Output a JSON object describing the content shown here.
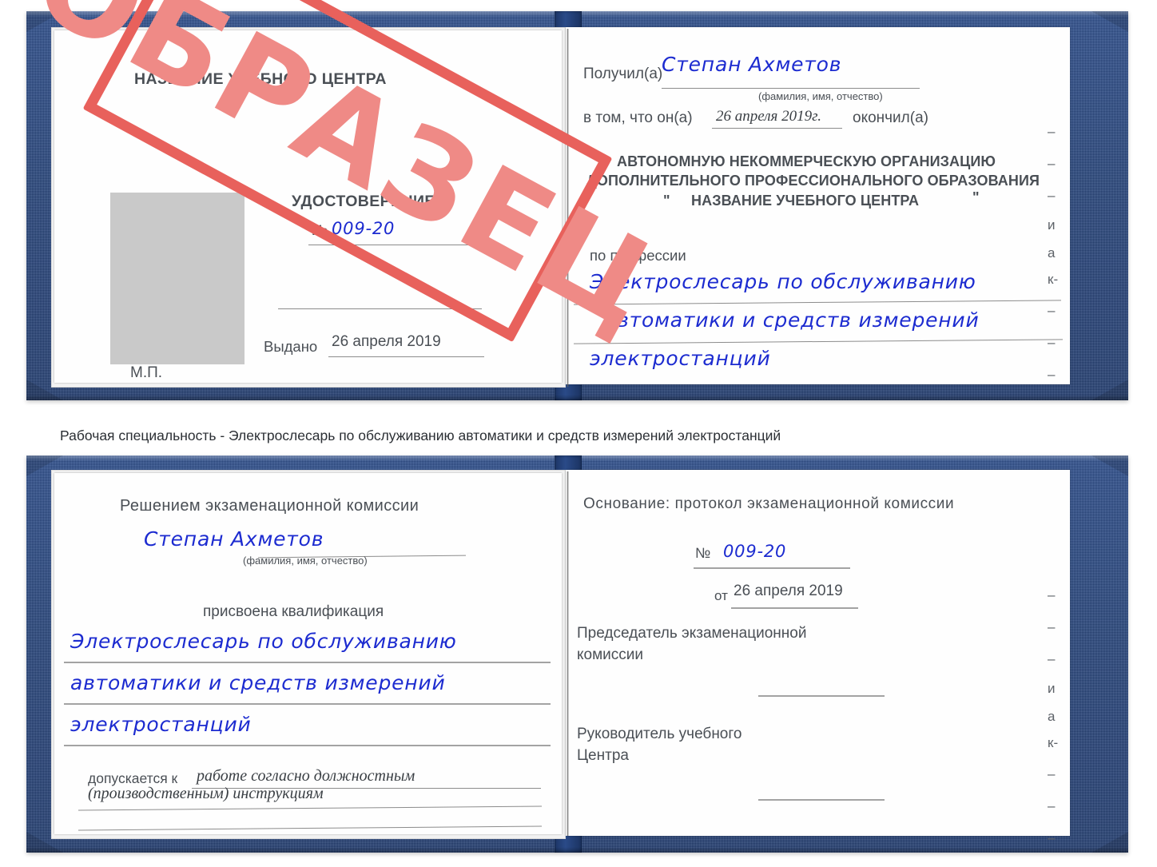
{
  "document": {
    "type": "certificate-book",
    "language": "ru"
  },
  "colors": {
    "cover_blue": "#27467f",
    "stamp_red": "#e8615c",
    "stamp_text": "#ef8a86",
    "handwriting_blue": "#1c2bd0",
    "photo_placeholder_gray": "#c9c9c9",
    "printed_text": "#4a4f55"
  },
  "stamp": {
    "text": "ОБРАЗЕЦ"
  },
  "top_certificate": {
    "left_page": {
      "center_name": "НАЗВАНИЕ УЧЕБНОГО ЦЕНТРА",
      "doc_type": "УДОСТОВЕРЕНИЕ",
      "number_label": "№",
      "number_value": "009-20",
      "issued_label": "Выдано",
      "issued_value": "26 апреля 2019",
      "seal_label": "М.П."
    },
    "right_page": {
      "received_label": "Получил(а)",
      "received_value": "Степан Ахметов",
      "fio_hint": "(фамилия, имя, отчество)",
      "in_that_label": "в том, что он(а)",
      "completion_date": "26 апреля 2019г.",
      "finished_label": "окончил(а)",
      "org_line1": "АВТОНОМНУЮ НЕКОММЕРЧЕСКУЮ ОРГАНИЗАЦИЮ",
      "org_line2": "ДОПОЛНИТЕЛЬНОГО ПРОФЕССИОНАЛЬНОГО ОБРАЗОВАНИЯ",
      "org_quote_open": "\"",
      "org_line3": "НАЗВАНИЕ УЧЕБНОГО ЦЕНТРА",
      "org_quote_close": "\"",
      "profession_label": "по профессии",
      "profession_line1": "Электрослесарь по обслуживанию",
      "profession_line2": "автоматики и средств измерений",
      "profession_line3": "электростанций",
      "margin_marks": [
        "–",
        "–",
        "–",
        "и",
        "а",
        "к-",
        "–",
        "–",
        "–"
      ]
    }
  },
  "caption": {
    "text": "Рабочая специальность - Электрослесарь по обслуживанию автоматики и средств измерений электростанций"
  },
  "bottom_certificate": {
    "left_page": {
      "decision_label": "Решением экзаменационной комиссии",
      "name_value": "Степан Ахметов",
      "fio_hint": "(фамилия, имя, отчество)",
      "qualification_label": "присвоена квалификация",
      "qualification_line1": "Электрослесарь по обслуживанию",
      "qualification_line2": "автоматики и средств измерений",
      "qualification_line3": "электростанций",
      "admitted_label": "допускается к",
      "admitted_value_line1": "работе согласно должностным",
      "admitted_value_line2": "(производственным) инструкциям"
    },
    "right_page": {
      "basis_label": "Основание: протокол экзаменационной комиссии",
      "number_label": "№",
      "number_value": "009-20",
      "date_label": "от",
      "date_value": "26 апреля 2019",
      "chairman_line1": "Председатель экзаменационной",
      "chairman_line2": "комиссии",
      "head_line1": "Руководитель учебного",
      "head_line2": "Центра",
      "margin_marks": [
        "–",
        "–",
        "–",
        "и",
        "а",
        "к-",
        "–",
        "–",
        "–"
      ]
    }
  }
}
